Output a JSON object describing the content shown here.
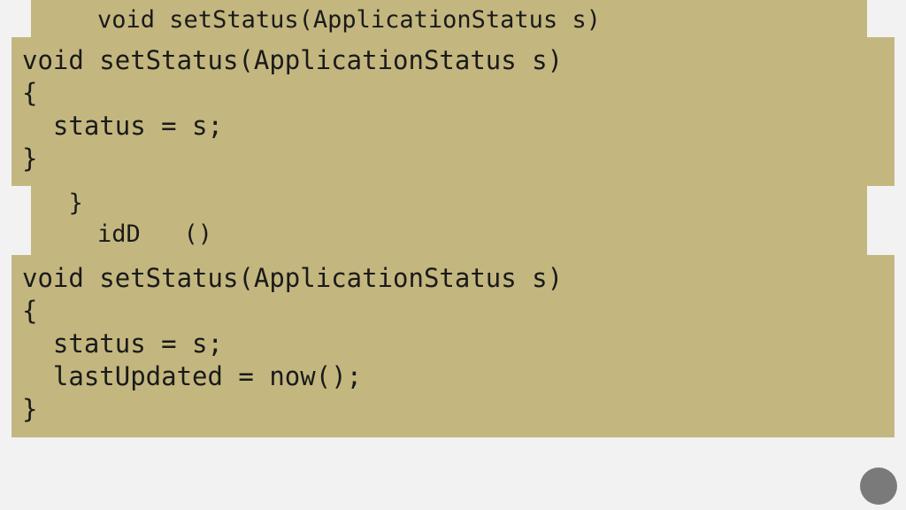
{
  "back_layer": "    void setStatus(ApplicationStatus s)\n    {\n      status = s;\n      lastUpdated = now();        ed;\n    }\n    // . . .\n  }\n    idD   ()",
  "front_top": "void setStatus(ApplicationStatus s)\n{\n  status = s;\n}",
  "front_bottom": "void setStatus(ApplicationStatus s)\n{\n  status = s;\n  lastUpdated = now();\n}"
}
